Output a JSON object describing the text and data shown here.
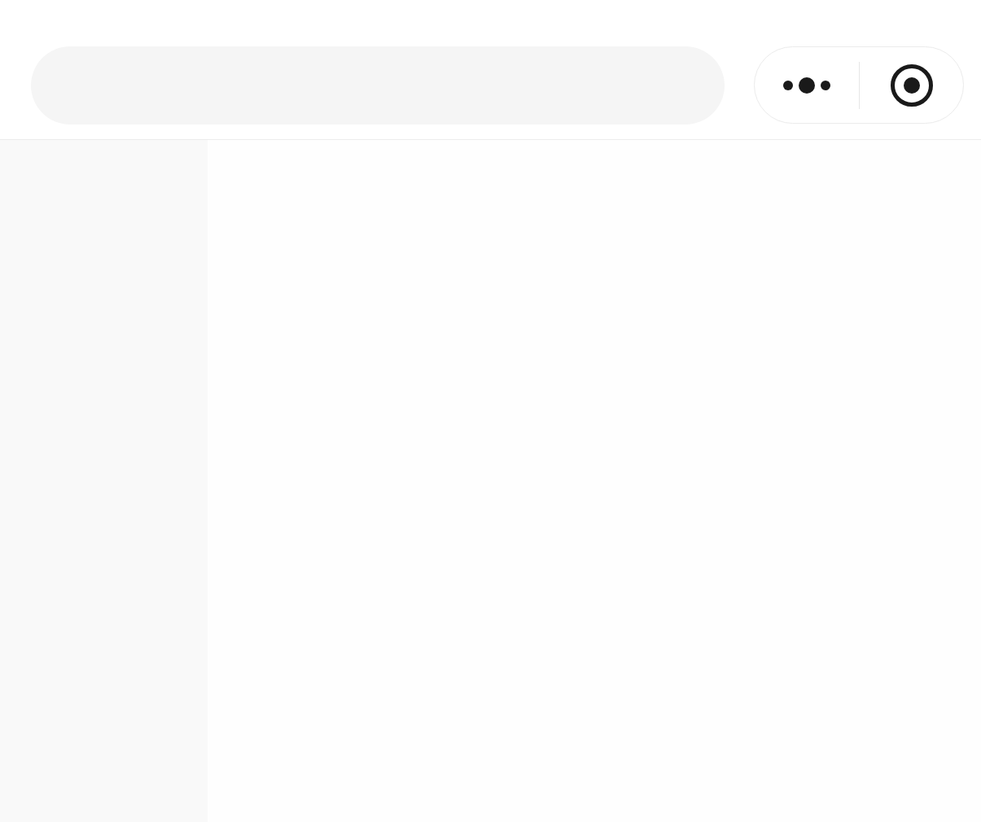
{
  "capsule": {
    "buttons": [
      {
        "kind": "more"
      },
      {
        "kind": "close"
      }
    ]
  }
}
